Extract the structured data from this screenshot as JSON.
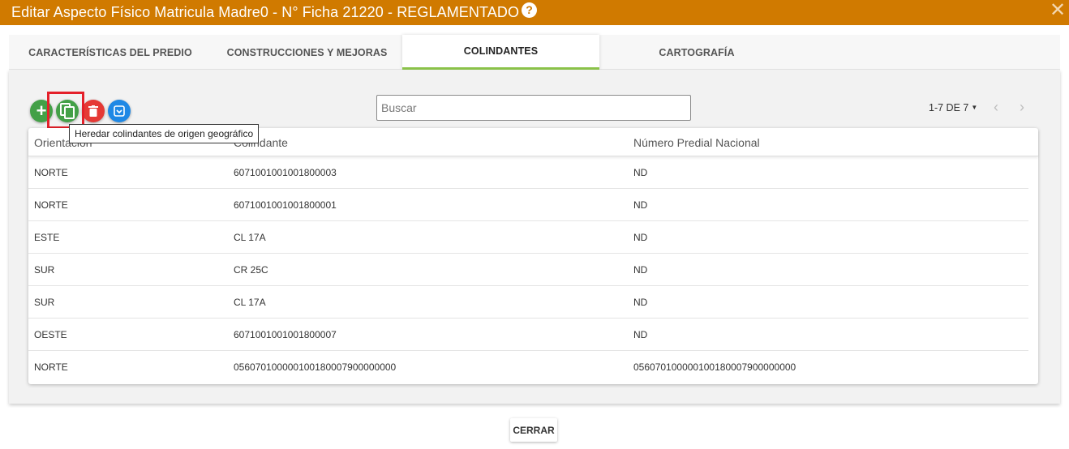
{
  "titlebar": {
    "title": "Editar Aspecto Físico Matricula Madre0 - N° Ficha 21220 - REGLAMENTADO",
    "help_icon": "?",
    "close_icon": "✕"
  },
  "tabs": [
    {
      "label": "CARACTERÍSTICAS DEL PREDIO",
      "active": false
    },
    {
      "label": "CONSTRUCCIONES Y MEJORAS",
      "active": false
    },
    {
      "label": "COLINDANTES",
      "active": true
    },
    {
      "label": "CARTOGRAFÍA",
      "active": false
    }
  ],
  "toolbar": {
    "add_icon": "+",
    "copy_tooltip": "Heredar colindantes de origen geográfico",
    "colors": {
      "add": "#43a047",
      "copy": "#43a047",
      "delete": "#e53935",
      "save": "#1e88e5",
      "highlight": "#e4202a"
    }
  },
  "search": {
    "placeholder": "Buscar"
  },
  "pager": {
    "label": "1-7 DE 7",
    "caret": "▼",
    "prev": "‹",
    "next": "›"
  },
  "table": {
    "headers": [
      "Orientación",
      "Colindante",
      "Número Predial Nacional"
    ],
    "rows": [
      [
        "NORTE",
        "6071001001001800003",
        "ND"
      ],
      [
        "NORTE",
        "6071001001001800001",
        "ND"
      ],
      [
        "ESTE",
        "CL 17A",
        "ND"
      ],
      [
        "SUR",
        "CR 25C",
        "ND"
      ],
      [
        "SUR",
        "CL 17A",
        "ND"
      ],
      [
        "OESTE",
        "6071001001001800007",
        "ND"
      ],
      [
        "NORTE",
        "056070100000100180007900000000",
        "056070100000100180007900000000"
      ]
    ]
  },
  "footer": {
    "close_label": "CERRAR"
  },
  "colors": {
    "titlebar": "#d07a00",
    "tab_active_underline": "#8bc34a"
  }
}
